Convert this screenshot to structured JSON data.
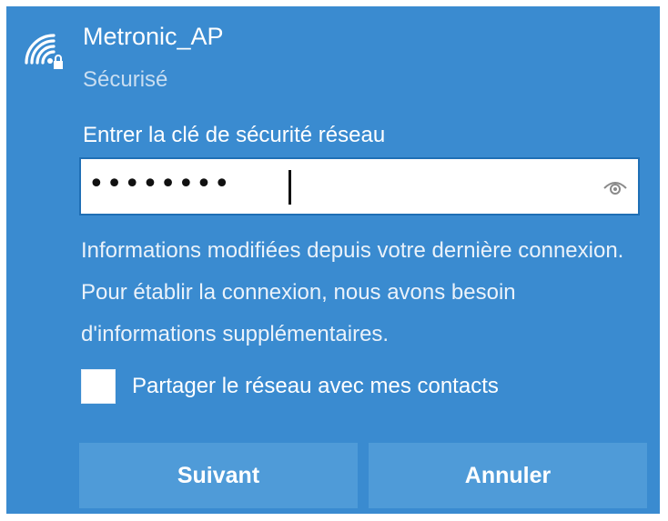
{
  "network": {
    "name": "Metronic_AP",
    "status": "Sécurisé",
    "icon": "wifi-secure-icon"
  },
  "password": {
    "label": "Entrer la clé de sécurité réseau",
    "masked_value": "••••••••",
    "reveal_icon": "eye-icon"
  },
  "info": {
    "message": "Informations modifiées depuis votre dernière connexion. Pour établir la connexion, nous avons besoin d'informations supplémentaires."
  },
  "share": {
    "label": "Partager le réseau avec mes contacts",
    "checked": false
  },
  "buttons": {
    "next_label": "Suivant",
    "cancel_label": "Annuler"
  },
  "colors": {
    "panel_background": "#3a8bd0",
    "button_background": "#4f9bd8",
    "text": "#ffffff"
  }
}
